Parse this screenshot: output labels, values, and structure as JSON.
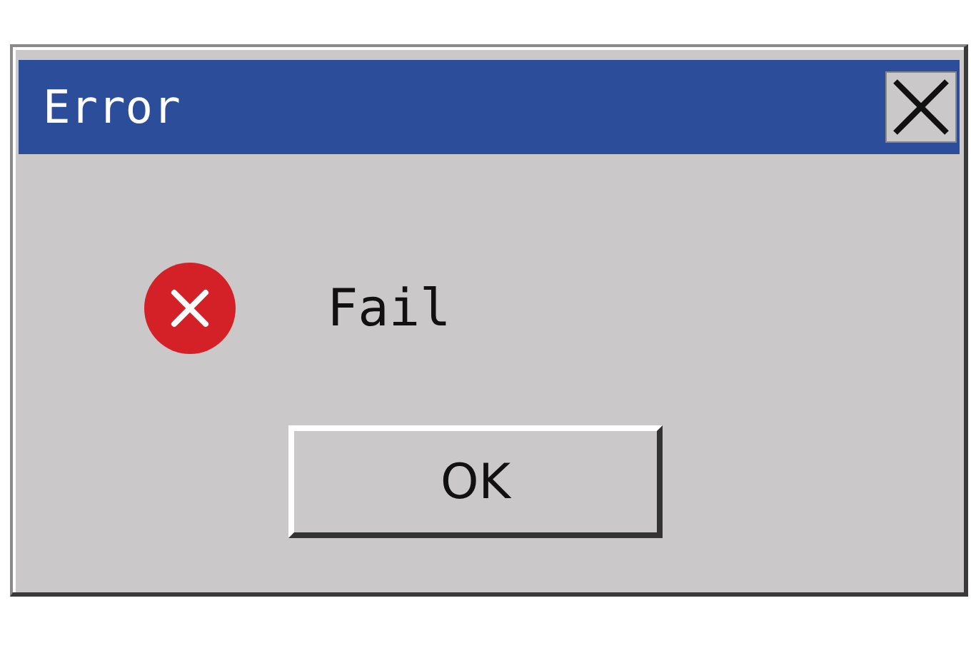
{
  "window": {
    "title": "Error"
  },
  "message": {
    "text": "Fail"
  },
  "buttons": [
    "OK"
  ]
}
